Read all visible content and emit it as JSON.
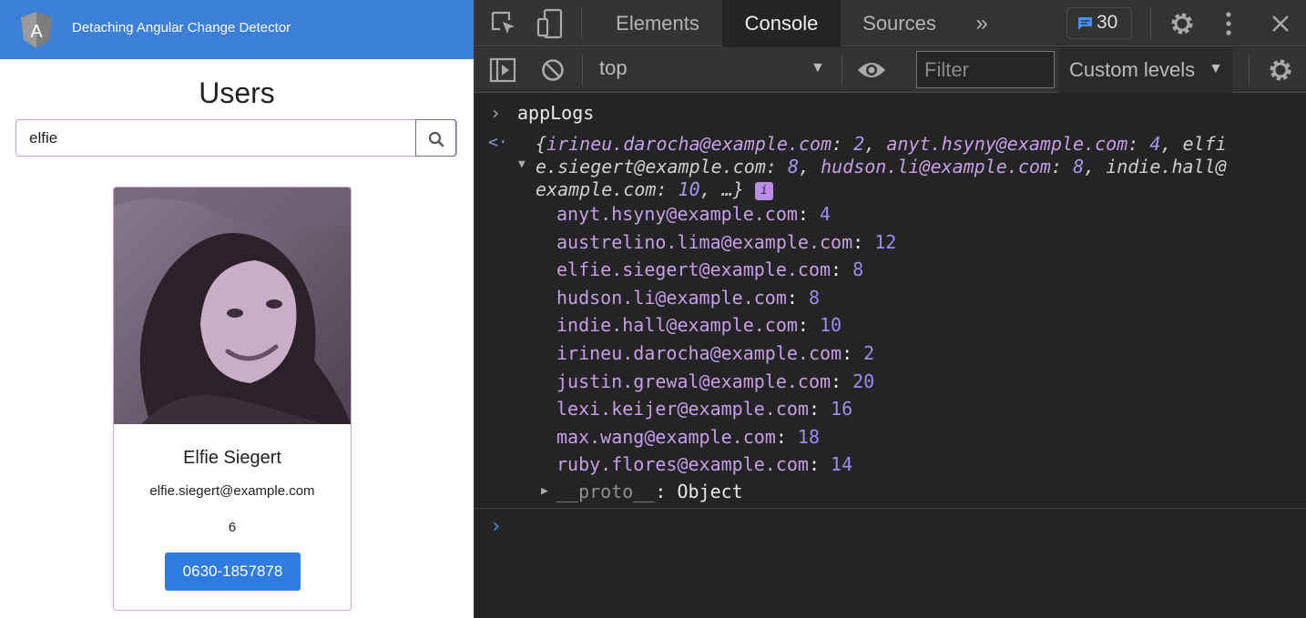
{
  "app": {
    "title": "Detaching Angular Change Detector",
    "logo_letter": "A",
    "page_title": "Users",
    "search": {
      "value": "elfie",
      "placeholder": ""
    },
    "card": {
      "name": "Elfie Siegert",
      "email": "elfie.siegert@example.com",
      "count": "6",
      "phone": "0630-1857878"
    }
  },
  "devtools": {
    "tabs": [
      "Elements",
      "Console",
      "Sources"
    ],
    "active_tab": "Console",
    "more_tabs": "»",
    "issues_count": "30",
    "toolbar": {
      "context": "top",
      "filter_placeholder": "Filter",
      "levels": "Custom levels"
    },
    "console": {
      "command": "appLogs",
      "summary_lines": [
        "{irineu.darocha@example.com: 2, anyt.hsyny@example.com: 4, elfi",
        "e.siegert@example.com: 8, hudson.li@example.com: 8, indie.hall@",
        "example.com: 10, …}"
      ],
      "summary_pairs": [
        {
          "key": "irineu.darocha@example.com",
          "value": "2"
        },
        {
          "key": "anyt.hsyny@example.com",
          "value": "4"
        },
        {
          "key": "elfie.siegert@example.com",
          "value": "8"
        },
        {
          "key": "hudson.li@example.com",
          "value": "8"
        },
        {
          "key": "indie.hall@example.com",
          "value": "10"
        }
      ],
      "info_badge": "i",
      "entries": [
        {
          "key": "anyt.hsyny@example.com",
          "value": "4"
        },
        {
          "key": "austrelino.lima@example.com",
          "value": "12"
        },
        {
          "key": "elfie.siegert@example.com",
          "value": "8"
        },
        {
          "key": "hudson.li@example.com",
          "value": "8"
        },
        {
          "key": "indie.hall@example.com",
          "value": "10"
        },
        {
          "key": "irineu.darocha@example.com",
          "value": "2"
        },
        {
          "key": "justin.grewal@example.com",
          "value": "20"
        },
        {
          "key": "lexi.keijer@example.com",
          "value": "16"
        },
        {
          "key": "max.wang@example.com",
          "value": "18"
        },
        {
          "key": "ruby.flores@example.com",
          "value": "14"
        }
      ],
      "proto": {
        "key": "__proto__",
        "value": "Object"
      }
    },
    "icons": [
      "inspect-element-icon",
      "device-toolbar-icon",
      "message-icon",
      "settings-gear-icon",
      "more-vertical-icon",
      "close-icon",
      "sidebar-toggle-icon",
      "clear-console-icon",
      "eye-icon",
      "console-settings-gear-icon",
      "search-icon"
    ]
  },
  "colors": {
    "header": "#3b7fd9",
    "phone_button": "#2f7be0",
    "devtools_bg": "#242424",
    "console_key": "#c79ee8",
    "console_value": "#9b8cf3",
    "input_prompt": "#4a8ee6"
  }
}
